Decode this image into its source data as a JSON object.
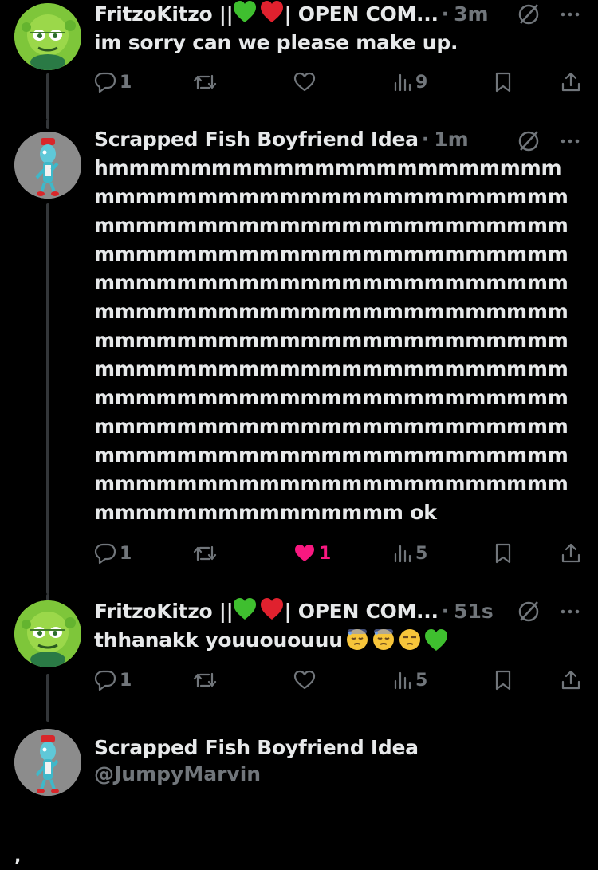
{
  "tweets": [
    {
      "name": "FritzoKitzo ||",
      "name_suffix": "| OPEN COM...",
      "time": "3m",
      "text": "im sorry can we please make up.",
      "replies": "1",
      "likes": "",
      "views": "9"
    },
    {
      "name": "Scrapped Fish Boyfriend Idea",
      "time": "1m",
      "text": "hmmmmmmmmmmmmmmmmmmmmmmmmmmmmmmmmmmmmmmmmmmmmmmmmmmmmmmmmmmmmmmmmmmmmmmmmmmmmmmmmmmmmmmmmmmmmmmmmmmmmmmmmmmmmmmmmmmmmmmmmmmmmmmmmmmmmmmmmmmmmmmmmmmmmmmmmmmmmmmmmmmmmmmmmmmmmmmmmmmmmmmmmmmmmmmmmmmmmmmmmmmmmmmmmmmmmmmmmmmmmmmmmmmmmmmmmmmmmmmmmmmmmmmmmmmmmmmmmmmmmmmmmmmmmmmmmmmmmmmmmmmmmmmmmmm ok",
      "replies": "1",
      "likes": "1",
      "views": "5"
    },
    {
      "name": "FritzoKitzo ||",
      "name_suffix": "| OPEN COM...",
      "time": "51s",
      "text": "thhanakk youuououuu",
      "replies": "1",
      "likes": "",
      "views": "5"
    }
  ],
  "composer": {
    "name": "Scrapped Fish Boyfriend Idea",
    "handle": "@JumpyMarvin"
  },
  "corner_mark": ",",
  "colors": {
    "background": "#000000",
    "text": "#e7e9ea",
    "secondary": "#71767b",
    "like": "#f91880",
    "thread_line": "#333639",
    "green_heart": "#3fbf2f",
    "red_heart": "#e0212e"
  },
  "icons": [
    "reply-icon",
    "retweet-icon",
    "like-icon",
    "views-icon",
    "bookmark-icon",
    "share-icon",
    "grok-icon",
    "more-icon"
  ]
}
